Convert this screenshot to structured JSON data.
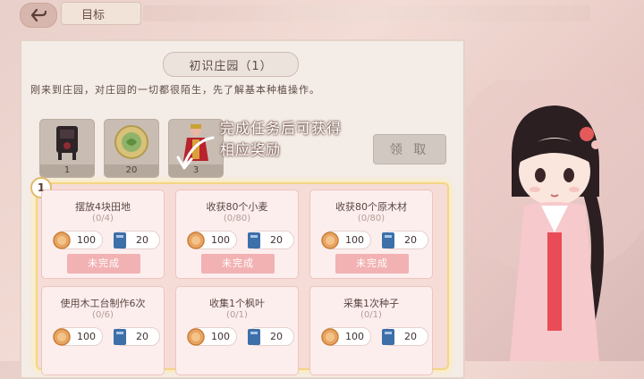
{
  "header": {
    "title": "目标"
  },
  "task": {
    "title": "初识庄园（1）",
    "description": "刚来到庄园，对庄园的一切都很陌生，先了解基本种植操作。"
  },
  "rewards": [
    {
      "icon": "furniture-icon",
      "count": "1"
    },
    {
      "icon": "coin-icon",
      "count": "20"
    },
    {
      "icon": "outfit-icon",
      "count": "3"
    }
  ],
  "claim_label": "领 取",
  "hint": {
    "line1": "完成任务后可获得",
    "line2": "相应奖励"
  },
  "step": "1",
  "subtasks": [
    {
      "name": "摆放4块田地",
      "progress": "(0/4)",
      "coins": "100",
      "books": "20",
      "status": "未完成"
    },
    {
      "name": "收获80个小麦",
      "progress": "(0/80)",
      "coins": "100",
      "books": "20",
      "status": "未完成"
    },
    {
      "name": "收获80个原木材",
      "progress": "(0/80)",
      "coins": "100",
      "books": "20",
      "status": "未完成"
    },
    {
      "name": "使用木工台制作6次",
      "progress": "(0/6)",
      "coins": "100",
      "books": "20",
      "status": ""
    },
    {
      "name": "收集1个枫叶",
      "progress": "(0/1)",
      "coins": "100",
      "books": "20",
      "status": ""
    },
    {
      "name": "采集1次种子",
      "progress": "(0/1)",
      "coins": "100",
      "books": "20",
      "status": ""
    }
  ],
  "colors": {
    "accent": "#f2b2b3",
    "highlight": "#f2d683",
    "panel": "#f4ece6"
  }
}
